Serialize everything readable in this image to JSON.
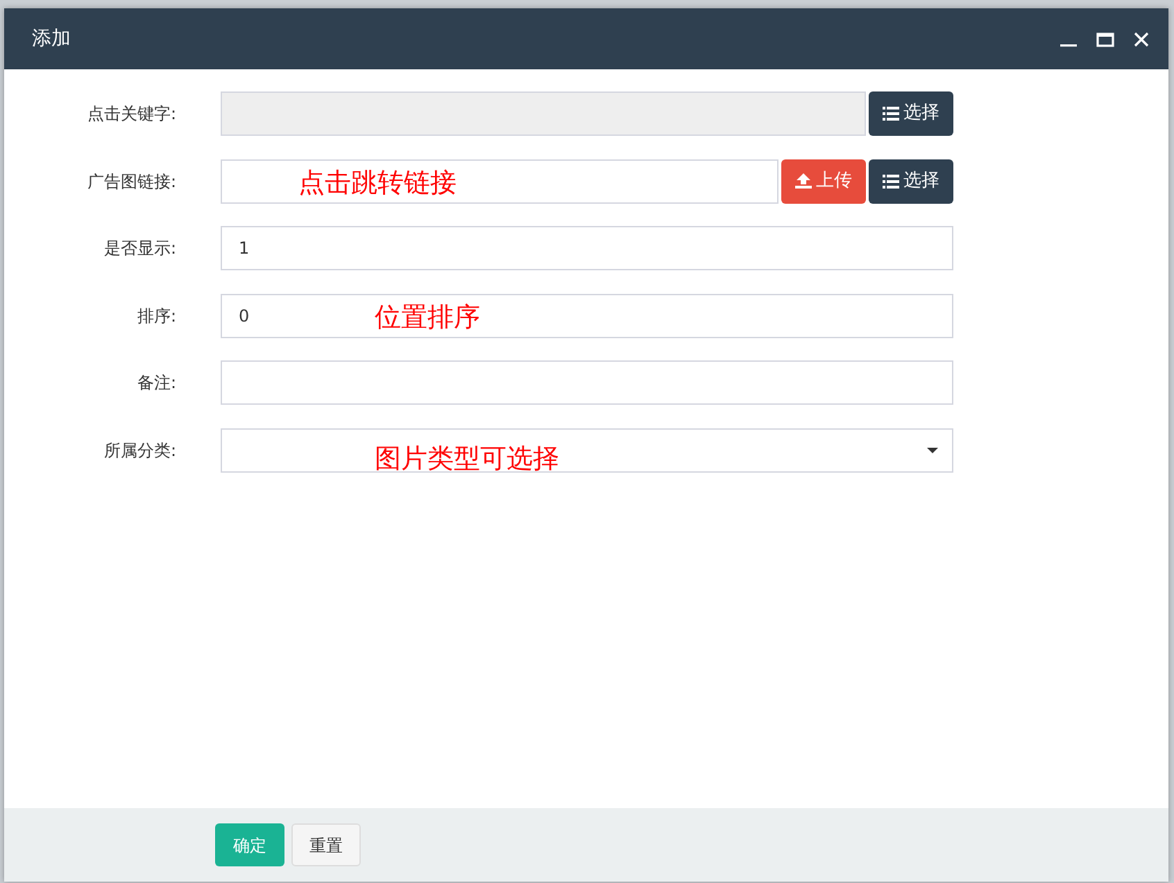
{
  "window": {
    "title": "添加"
  },
  "fields": [
    {
      "kind": "picker",
      "label": "点击关键字:",
      "disabled": true,
      "buttons": [
        {
          "kind": "list",
          "label": "选择"
        }
      ]
    },
    {
      "kind": "upload",
      "label": "广告图链接:",
      "disabled": false,
      "annotation": "点击跳转链接",
      "buttons": [
        {
          "kind": "upload",
          "label": "上传"
        },
        {
          "kind": "list",
          "label": "选择"
        }
      ]
    },
    {
      "kind": "text",
      "label": "是否显示:",
      "value": "1",
      "disabled": false
    },
    {
      "kind": "text",
      "label": "排序:",
      "value": "0",
      "disabled": false,
      "annotation": "位置排序"
    },
    {
      "kind": "text",
      "label": "备注:",
      "disabled": false
    },
    {
      "kind": "select",
      "label": "所属分类:",
      "disabled": false,
      "annotation": "图片类型可选择"
    }
  ],
  "footer": {
    "buttons": [
      {
        "kind": "primary",
        "label": "确定"
      },
      {
        "kind": "default",
        "label": "重置"
      }
    ]
  }
}
